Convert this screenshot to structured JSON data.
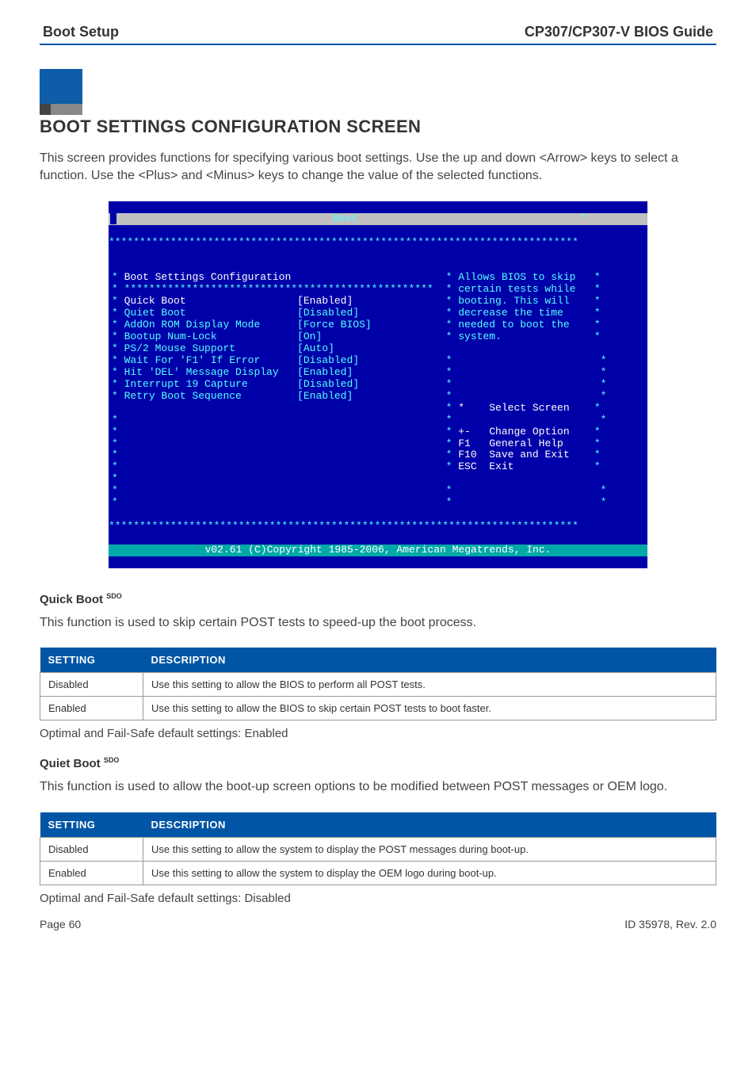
{
  "header": {
    "left": "Boot Setup",
    "right": "CP307/CP307-V BIOS Guide"
  },
  "section_title": "BOOT SETTINGS CONFIGURATION SCREEN",
  "intro_paragraph": "This screen provides functions for specifying various boot settings. Use the up and down <Arrow> keys to select a function. Use the <Plus> and <Minus> keys to change the value of the selected functions.",
  "bios": {
    "title_center": "Boot",
    "star_border": "****************************************************************************",
    "heading": "Boot Settings Configuration",
    "sub_border": "**************************************************",
    "rows": [
      {
        "label": "Quick Boot",
        "val": "[Enabled]",
        "class_label": "white",
        "class_val": "white"
      },
      {
        "label": "Quiet Boot",
        "val": "[Disabled]",
        "class_label": "cyan",
        "class_val": "cyan"
      },
      {
        "label": "AddOn ROM Display Mode",
        "val": "[Force BIOS]",
        "class_label": "cyan",
        "class_val": "cyan"
      },
      {
        "label": "Bootup Num-Lock",
        "val": "[On]",
        "class_label": "cyan",
        "class_val": "cyan"
      },
      {
        "label": "PS/2 Mouse Support",
        "val": "[Auto]",
        "class_label": "cyan",
        "class_val": "cyan"
      },
      {
        "label": "Wait For 'F1' If Error",
        "val": "[Disabled]",
        "class_label": "cyan",
        "class_val": "cyan"
      },
      {
        "label": "Hit 'DEL' Message Display",
        "val": "[Enabled]",
        "class_label": "cyan",
        "class_val": "cyan"
      },
      {
        "label": "Interrupt 19 Capture",
        "val": "[Disabled]",
        "class_label": "cyan",
        "class_val": "cyan"
      },
      {
        "label": "Retry Boot Sequence",
        "val": "[Enabled]",
        "class_label": "cyan",
        "class_val": "cyan"
      }
    ],
    "help_lines": [
      "Allows BIOS to skip",
      "certain tests while",
      "booting. This will",
      "decrease the time",
      "needed to boot the",
      "system."
    ],
    "legend": [
      {
        "key": "*",
        "text": "Select Screen"
      },
      {
        "key": "",
        "text": ""
      },
      {
        "key": "+-",
        "text": "Change Option"
      },
      {
        "key": "F1",
        "text": "General Help"
      },
      {
        "key": "F10",
        "text": "Save and Exit"
      },
      {
        "key": "ESC",
        "text": "Exit"
      }
    ],
    "copyright": "v02.61 (C)Copyright 1985-2006, American Megatrends, Inc."
  },
  "quick_boot": {
    "title": "Quick Boot",
    "sdo": "SDO",
    "intro": "This function is used to skip certain POST tests to speed-up the boot process.",
    "th_setting": "SETTING",
    "th_desc": "DESCRIPTION",
    "rows": [
      {
        "setting": "Disabled",
        "desc": "Use this setting to allow the BIOS to perform all POST tests."
      },
      {
        "setting": "Enabled",
        "desc": "Use this setting to allow the BIOS to skip certain POST tests to boot faster."
      }
    ],
    "default_note": "Optimal and Fail-Safe default settings: Enabled"
  },
  "quiet_boot": {
    "title": "Quiet Boot",
    "sdo": "SDO",
    "intro": "This function is used to allow the boot-up screen options to be modified between POST messages or OEM logo.",
    "th_setting": "SETTING",
    "th_desc": "DESCRIPTION",
    "rows": [
      {
        "setting": "Disabled",
        "desc": "Use this setting to allow the system to display the POST messages during boot-up."
      },
      {
        "setting": "Enabled",
        "desc": "Use this setting to allow the system to display the OEM logo during boot-up."
      }
    ],
    "default_note": "Optimal and Fail-Safe default settings: Disabled"
  },
  "footer": {
    "left": "Page 60",
    "right": "ID 35978, Rev. 2.0"
  }
}
